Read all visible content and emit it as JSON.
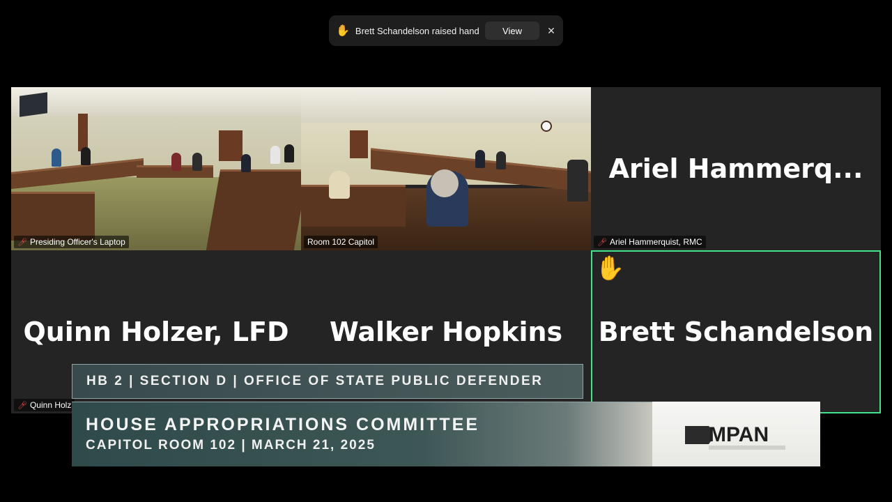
{
  "toast": {
    "message": "Brett Schandelson raised hand",
    "view_label": "View",
    "close_glyph": "✕",
    "hand_glyph": "✋"
  },
  "tiles": {
    "presiding": {
      "label": "Presiding Officer's Laptop",
      "muted": true
    },
    "room102": {
      "label": "Room 102 Capitol",
      "muted": false
    },
    "ariel": {
      "display_name": "Ariel  Hammerq...",
      "label": "Ariel Hammerquist, RMC",
      "muted": true
    },
    "quinn": {
      "display_name": "Quinn Holzer, LFD",
      "label": "Quinn Holz",
      "muted": true
    },
    "walker": {
      "display_name": "Walker Hopkins"
    },
    "brett": {
      "display_name": "Brett Schandelson",
      "hand_glyph": "✋",
      "active": true
    }
  },
  "lower_third": {
    "line_top": "HB 2 | SECTION D | OFFICE OF STATE PUBLIC DEFENDER",
    "title": "HOUSE APPROPRIATIONS COMMITTEE",
    "subtitle": "CAPITOL ROOM 102 | MARCH 21, 2025",
    "logo_text": "MPAN"
  },
  "colors": {
    "active_border": "#3ee58a",
    "mute_icon": "#e5474b",
    "raise_hand": "#f5b92c",
    "tile_bg": "#242424"
  }
}
